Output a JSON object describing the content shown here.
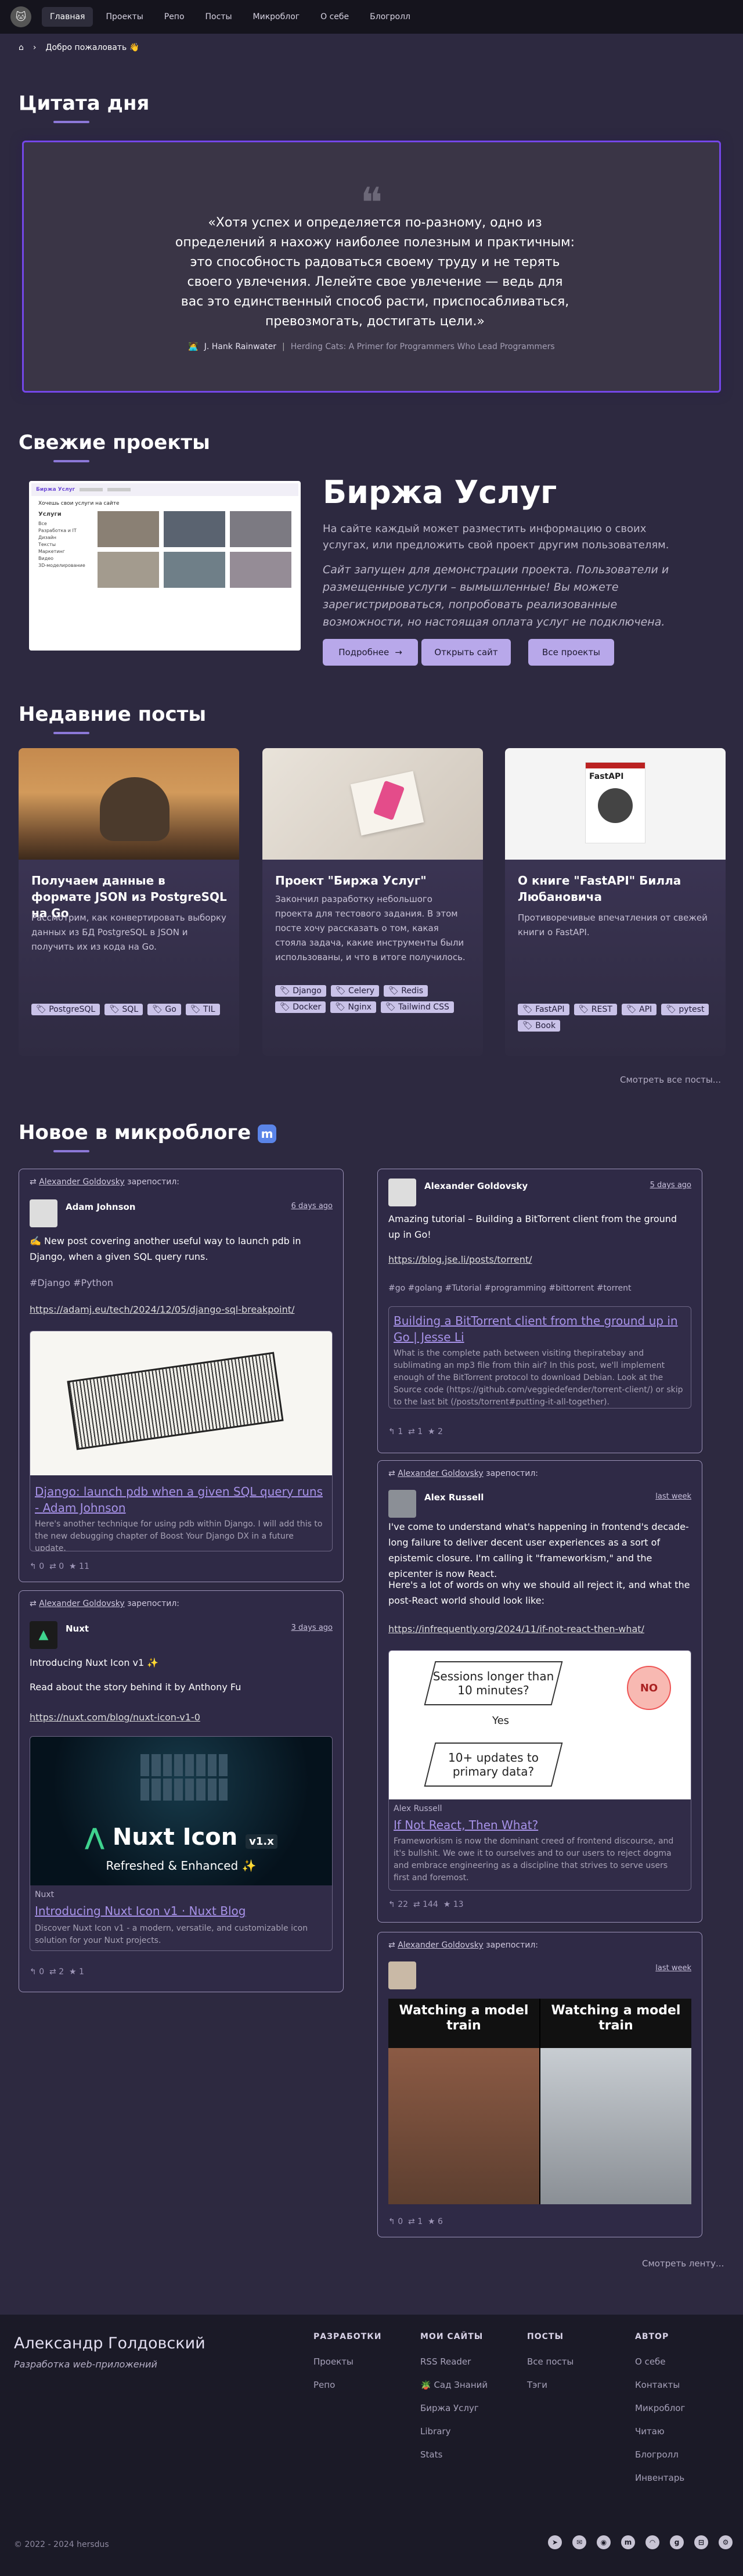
{
  "nav": {
    "items": [
      "Главная",
      "Проекты",
      "Репо",
      "Посты",
      "Микроблог",
      "О себе",
      "Блогролл"
    ]
  },
  "breadcrumb": {
    "label": "Добро пожаловать 👋"
  },
  "quote": {
    "section_title": "Цитата дня",
    "text": "«Хотя успех и определяется по-разному, одно из определений я нахожу наиболее полезным и практичным: это способность радоваться своему труду и не терять своего увлечения. Лелейте свое увлечение — ведь для вас это единственный способ расти, приспосабливаться, превозмогать, достигать цели.»",
    "author": "J. Hank Rainwater",
    "book": "Herding Cats: A Primer for Programmers Who Lead Programmers"
  },
  "projects": {
    "section_title": "Свежие проекты",
    "title": "Биржа Услуг",
    "description": "На сайте каждый может разместить информацию о своих услугах, или предложить свой проект другим пользователям.",
    "note": "Сайт запущен для демонстрации проекта. Пользователи и размещенные услуги – вымышленные! Вы можете зарегистрироваться, попробовать реализованные возможности, но настоящая оплата услуг не подключена.",
    "btn_more": "Подробнее",
    "btn_open": "Открыть сайт",
    "btn_all": "Все проекты",
    "screenshot": {
      "brand": "Биржа Услуг",
      "heading": "Хочешь свои услуги на сайте",
      "section": "Услуги",
      "filters": [
        "Все",
        "Разработка и IT",
        "Дизайн",
        "Тексты",
        "Маркетинг",
        "Видео",
        "3D-моделирование"
      ]
    }
  },
  "posts": {
    "section_title": "Недавние посты",
    "more": "Смотреть все посты...",
    "items": [
      {
        "title": "Получаем данные в формате JSON из PostgreSQL на Go",
        "body": "Рассмотрим, как конвертировать выборку данных из БД PostgreSQL в JSON и получить их из кода на Go.",
        "tags": [
          "PostgreSQL",
          "SQL",
          "Go",
          "TIL"
        ]
      },
      {
        "title": "Проект \"Биржа Услуг\"",
        "body": "Закончил разработку небольшого проекта для тестового задания. В этом посте хочу рассказать о том, какая стояла задача, какие инструменты были использованы, и что в итоге получилось.",
        "tags": [
          "Django",
          "Celery",
          "Redis",
          "Docker",
          "Nginx",
          "Tailwind CSS"
        ]
      },
      {
        "title": "О книге \"FastAPI\" Билла Любановича",
        "body": "Противоречивые впечатления от свежей книги о FastAPI.",
        "tags": [
          "FastAPI",
          "REST",
          "API",
          "pytest",
          "Book"
        ],
        "cover_title": "FastAPI"
      }
    ]
  },
  "micro": {
    "section_title": "Новое в микроблоге",
    "more": "Смотреть ленту...",
    "reposted": "зарепостил:",
    "booster": "Alexander Goldovsky",
    "toots": [
      {
        "user": "Adam Johnson",
        "date": "6 days ago",
        "text": "✍️ New post covering another useful way to launch pdb in Django, when a given SQL query runs.",
        "tags": "#Django #Python",
        "link": "https://adamj.eu/tech/2024/12/05/django-sql-breakpoint/",
        "card_title": "Django: launch pdb when a given SQL query runs - Adam Johnson",
        "card_desc": "Here's another technique for using pdb within Django. I will add this to the new debugging chapter of Boost Your Django DX in a future update.",
        "replies": "0",
        "boosts": "0",
        "favs": "11"
      },
      {
        "user": "Nuxt",
        "date": "3 days ago",
        "text1": "Introducing Nuxt Icon v1 ✨",
        "text2": "Read about the story behind it by Anthony Fu",
        "link": "https://nuxt.com/blog/nuxt-icon-v1-0",
        "card_brand": "Nuxt Icon",
        "card_version": "v1.x",
        "card_tagline": "Refreshed & Enhanced ✨",
        "card_site": "Nuxt",
        "card_title": "Introducing Nuxt Icon v1 · Nuxt Blog",
        "card_desc": "Discover Nuxt Icon v1 - a modern, versatile, and customizable icon solution for your Nuxt projects.",
        "replies": "0",
        "boosts": "2",
        "favs": "1"
      },
      {
        "user": "Alexander Goldovsky",
        "date": "5 days ago",
        "text": "Amazing tutorial – Building a BitTorrent client from the ground up in Go!",
        "link": "https://blog.jse.li/posts/torrent/",
        "tags": "#go #golang #Tutorial #programming #bittorrent #torrent",
        "card_title": "Building a BitTorrent client from the ground up in Go | Jesse Li",
        "card_desc": "What is the complete path between visiting thepiratebay and sublimating an mp3 file from thin air? In this post, we'll implement enough of the BitTorrent protocol to download Debian. Look at the Source code (https://github.com/veggiedefender/torrent-client/) or skip to the last bit (/posts/torrent#putting-it-all-together).",
        "replies": "1",
        "boosts": "1",
        "favs": "2"
      },
      {
        "user": "Alex Russell",
        "date": "last week",
        "text1": "I've come to understand what's happening in frontend's decade-long failure to deliver decent user experiences as a sort of epistemic closure. I'm calling it \"frameworkism,\" and the epicenter is now React.",
        "text2": "Here's a lot of words on why we should all reject it, and what the post-React world should look like:",
        "link": "https://infrequently.org/2024/11/if-not-react-then-what/",
        "flow_q1": "Sessions longer than 10 minutes?",
        "flow_no": "NO",
        "flow_yes": "Yes",
        "flow_q2": "10+ updates to primary data?",
        "card_site": "Alex Russell",
        "card_title": "If Not React, Then What?",
        "card_desc": "Frameworkism is now the dominant creed of frontend discourse, and it's bullshit. We owe it to ourselves and to our users to reject dogma and embrace engineering as a discipline that strives to serve users first and foremost.",
        "replies": "22",
        "boosts": "144",
        "favs": "13"
      },
      {
        "date": "last week",
        "caption_left": "Watching a model train",
        "caption_right": "Watching a model train",
        "replies": "0",
        "boosts": "1",
        "favs": "6"
      }
    ]
  },
  "footer": {
    "name": "Александр Голдовский",
    "subtitle": "Разработка web-приложений",
    "cols": [
      {
        "head": "РАЗРАБОТКИ",
        "links": [
          "Проекты",
          "Репо"
        ]
      },
      {
        "head": "МОИ САЙТЫ",
        "links": [
          "RSS Reader",
          "🪴 Сад Знаний",
          "Биржа Услуг",
          "Library",
          "Stats"
        ]
      },
      {
        "head": "ПОСТЫ",
        "links": [
          "Все посты",
          "Тэги"
        ]
      },
      {
        "head": "АВТОР",
        "links": [
          "О себе",
          "Контакты",
          "Микроблог",
          "Читаю",
          "Блогролл",
          "Инвентарь"
        ]
      }
    ],
    "copyright": "© 2022 - 2024 hersdus"
  },
  "colors": {
    "accent": "#8c78d8",
    "quote_border": "#7447e8",
    "tag_bg": "#c9c2e8"
  }
}
